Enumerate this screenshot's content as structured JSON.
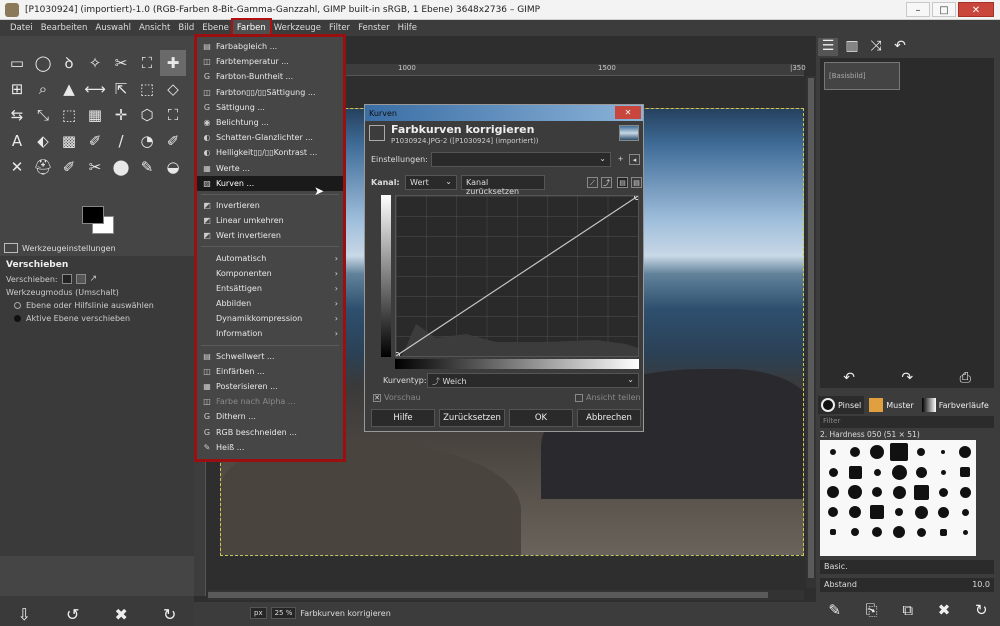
{
  "window": {
    "title": "[P1030924] (importiert)-1.0 (RGB-Farben 8-Bit-Gamma-Ganzzahl, GIMP built-in sRGB, 1 Ebene) 3648x2736 – GIMP",
    "min": "–",
    "max": "□",
    "close": "✕"
  },
  "menubar": [
    "Datei",
    "Bearbeiten",
    "Auswahl",
    "Ansicht",
    "Bild",
    "Ebene",
    "Farben",
    "Werkzeuge",
    "Filter",
    "Fenster",
    "Hilfe"
  ],
  "farben_menu": {
    "items": [
      {
        "label": "Farbabgleich ...",
        "icon": "▤",
        "state": "normal"
      },
      {
        "label": "Farbtemperatur ...",
        "icon": "◫",
        "state": "normal"
      },
      {
        "label": "Farbton-Buntheit ...",
        "icon": "G",
        "state": "normal"
      },
      {
        "label": "Farbton▯▯/▯▯Sättigung ...",
        "icon": "◫",
        "state": "normal"
      },
      {
        "label": "Sättigung ...",
        "icon": "G",
        "state": "normal"
      },
      {
        "label": "Belichtung ...",
        "icon": "◉",
        "state": "normal"
      },
      {
        "label": "Schatten-Glanzlichter ...",
        "icon": "◐",
        "state": "normal"
      },
      {
        "label": "Helligkeit▯▯/▯▯Kontrast ...",
        "icon": "◐",
        "state": "normal"
      },
      {
        "label": "Werte ...",
        "icon": "▦",
        "state": "normal"
      },
      {
        "label": "Kurven ...",
        "icon": "▨",
        "state": "highlight"
      },
      {
        "sep": true
      },
      {
        "label": "Invertieren",
        "icon": "◩",
        "state": "normal"
      },
      {
        "label": "Linear umkehren",
        "icon": "◩",
        "state": "normal"
      },
      {
        "label": "Wert invertieren",
        "icon": "◩",
        "state": "normal"
      },
      {
        "sep": true
      },
      {
        "label": "Automatisch",
        "icon": "",
        "state": "normal",
        "submenu": true
      },
      {
        "label": "Komponenten",
        "icon": "",
        "state": "normal",
        "submenu": true
      },
      {
        "label": "Entsättigen",
        "icon": "",
        "state": "normal",
        "submenu": true
      },
      {
        "label": "Abbilden",
        "icon": "",
        "state": "normal",
        "submenu": true
      },
      {
        "label": "Dynamikkompression",
        "icon": "",
        "state": "normal",
        "submenu": true
      },
      {
        "label": "Information",
        "icon": "",
        "state": "normal",
        "submenu": true
      },
      {
        "sep": true
      },
      {
        "label": "Schwellwert ...",
        "icon": "▤",
        "state": "normal"
      },
      {
        "label": "Einfärben ...",
        "icon": "◫",
        "state": "normal"
      },
      {
        "label": "Posterisieren ...",
        "icon": "▦",
        "state": "normal"
      },
      {
        "label": "Farbe nach Alpha ...",
        "icon": "◫",
        "state": "disabled"
      },
      {
        "label": "Dithern ...",
        "icon": "G",
        "state": "normal"
      },
      {
        "label": "RGB beschneiden ...",
        "icon": "G",
        "state": "normal"
      },
      {
        "label": "Heiß ...",
        "icon": "✎",
        "state": "normal"
      }
    ]
  },
  "toolbox": {
    "tools": [
      "▭",
      "◯",
      "ꝺ",
      "✧",
      "✂",
      "⛶",
      "✚",
      "⊞",
      "⌕",
      "▲",
      "⟷",
      "⇱",
      "⬚",
      "◇",
      "⇆",
      "⤡",
      "⬚",
      "▦",
      "✛",
      "⬡",
      "⛶",
      "A",
      "⬖",
      "▩",
      "✐",
      "/",
      "◔",
      "✐",
      "✕",
      "⛑",
      "✐",
      "✂",
      "⬤",
      "✎",
      "◒"
    ],
    "selected_index": 6,
    "tool_options_tab": "Werkzeugeinstellungen",
    "tool_name": "Verschieben",
    "move_label": "Verschieben:",
    "mode_label": "Werkzeugmodus (Umschalt)",
    "option1": "Ebene oder Hilfslinie auswählen",
    "option2": "Aktive Ebene verschieben",
    "bottom_icons": [
      "⇩",
      "↺",
      "✖",
      "↻"
    ]
  },
  "canvas": {
    "ruler": [
      "1000",
      "1500",
      "|350"
    ],
    "zoom_unit": "px",
    "zoom": "25 %",
    "status": "Farbkurven korrigieren"
  },
  "dialog": {
    "window_title": "Kurven",
    "heading": "Farbkurven korrigieren",
    "subheading": "P1030924.JPG-2 ([P1030924] (importiert))",
    "settings_label": "Einstellungen:",
    "channel_label": "Kanal:",
    "channel_value": "Wert",
    "reset_channel": "Kanal zurücksetzen",
    "curve_type_label": "Kurventyp:",
    "curve_type_value": "Weich",
    "preview": "Vorschau",
    "split_view": "Ansicht teilen",
    "buttons": [
      "Hilfe",
      "Zurücksetzen",
      "OK",
      "Abbrechen"
    ]
  },
  "dock": {
    "layer_name": "[Basisbild]",
    "brush_tabs": [
      "Pinsel",
      "Muster",
      "Farbverläufe"
    ],
    "filter_placeholder": "Filter",
    "brush_name": "2. Hardness 050 (51 × 51)",
    "brush_set": "Basic.",
    "spacing_label": "Abstand",
    "spacing_value": "10.0"
  }
}
